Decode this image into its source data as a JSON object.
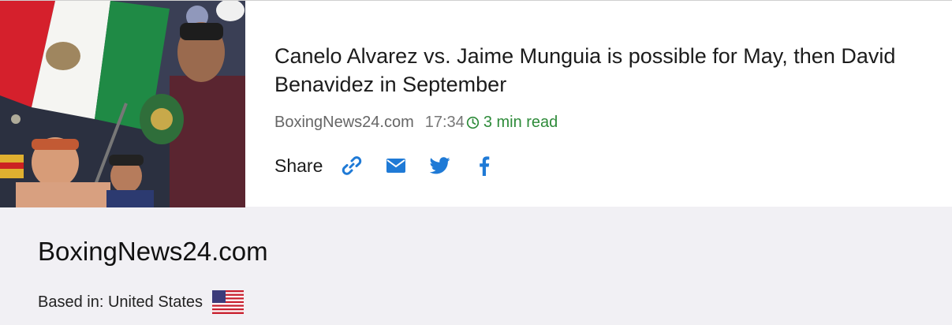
{
  "article": {
    "title": "Canelo Alvarez vs. Jaime Munguia is possible for May, then David Benavidez in September",
    "source": "BoxingNews24.com",
    "time": "17:34",
    "read_time": "3 min read",
    "thumbnail_icon": "boxing-photo"
  },
  "share": {
    "label": "Share",
    "buttons": [
      {
        "name": "link-icon"
      },
      {
        "name": "email-icon"
      },
      {
        "name": "twitter-icon"
      },
      {
        "name": "facebook-icon"
      }
    ],
    "accent_color": "#1f7ad6"
  },
  "source_info": {
    "name": "BoxingNews24.com",
    "based_in": "Based in: United States",
    "flag_icon": "us-flag-icon"
  },
  "colors": {
    "read_time": "#2e8b3a",
    "background": "#f1f0f4"
  }
}
